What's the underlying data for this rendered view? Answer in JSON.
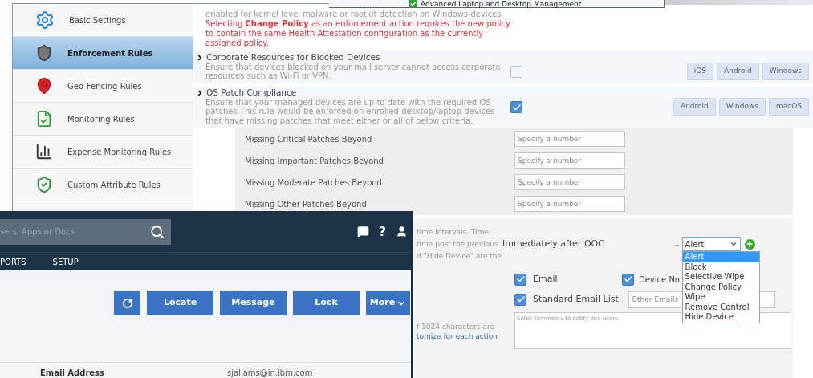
{
  "top_window": {
    "title": "Advanced Laptop and Desktop Management",
    "checked": true
  },
  "sidebar": {
    "items": [
      {
        "label": "Basic Settings",
        "selected": false
      },
      {
        "label": "Enforcement Rules",
        "selected": true
      },
      {
        "label": "Geo-Fencing Rules",
        "selected": false
      },
      {
        "label": "Monitoring Rules",
        "selected": false
      },
      {
        "label": "Expense Monitoring Rules",
        "selected": false
      },
      {
        "label": "Custom Attribute Rules",
        "selected": false
      }
    ]
  },
  "content": {
    "intro": "enabled for kernel level malware or rootkit detection on Windows devices.",
    "warning": "Selecting **Change Policy** as an enforcement action requires the new policy to contain the same Health Attestation configuration as the currently assigned policy.",
    "rules": [
      {
        "title": "Corporate Resources for Blocked Devices",
        "description": "Ensure that devices blocked on your mail server cannot access corporate resources such as Wi-Fi or VPN.",
        "checked": false,
        "platforms": [
          "iOS",
          "Android",
          "Windows"
        ]
      },
      {
        "title": "OS Patch Compliance",
        "description": "Ensure that your managed devices are up to date with the required OS patches.This rule would be enforced on enrolled desktop/laptop devices that have missing patches that meet either or all of below criteria.",
        "checked": true,
        "platforms": [
          "Android",
          "Windows",
          "macOS"
        ]
      }
    ],
    "patch_criteria": [
      {
        "label": "Missing Critical Patches Beyond",
        "placeholder": "Specify a number"
      },
      {
        "label": "Missing Important Patches Beyond",
        "placeholder": "Specify a number"
      },
      {
        "label": "Missing Moderate Patches Beyond",
        "placeholder": "Specify a number"
      },
      {
        "label": "Missing Other Patches Beyond",
        "placeholder": "Specify a number"
      }
    ],
    "schedule_fragments": [
      "time intervals. Time",
      "time post the previous",
      "d \"Hide Device\" are the"
    ],
    "schedule": {
      "label": "Immediately after OOC",
      "separator": "-",
      "value": "Alert",
      "options": [
        {
          "label": "Alert",
          "selected": true
        },
        {
          "label": "Block",
          "selected": false
        },
        {
          "label": "Selective Wipe",
          "selected": false
        },
        {
          "label": "Change Policy",
          "selected": false
        },
        {
          "label": "Wipe",
          "selected": false
        },
        {
          "label": "Remove Control",
          "selected": false
        },
        {
          "label": "Hide Device",
          "selected": false
        }
      ]
    },
    "notify": [
      {
        "label": "Email",
        "checked": true
      },
      {
        "label": "Device No",
        "checked": true
      },
      {
        "label": "Standard Email List",
        "checked": true
      }
    ],
    "other_emails_placeholder": "Other Emails",
    "comment_fragment": "f 1024 characters are",
    "comment_link": "tomize for each action",
    "comment_placeholder": "Enter comments to notify end users."
  },
  "device_window": {
    "help_label": "?",
    "search_placeholder": "sers, Apps or Docs",
    "nav": [
      "PORTS",
      "SETUP"
    ],
    "actions": [
      "Locate",
      "Message",
      "Lock",
      "More"
    ],
    "email_label": "Email Address",
    "email_value": "sjallams@in.ibm.com"
  }
}
